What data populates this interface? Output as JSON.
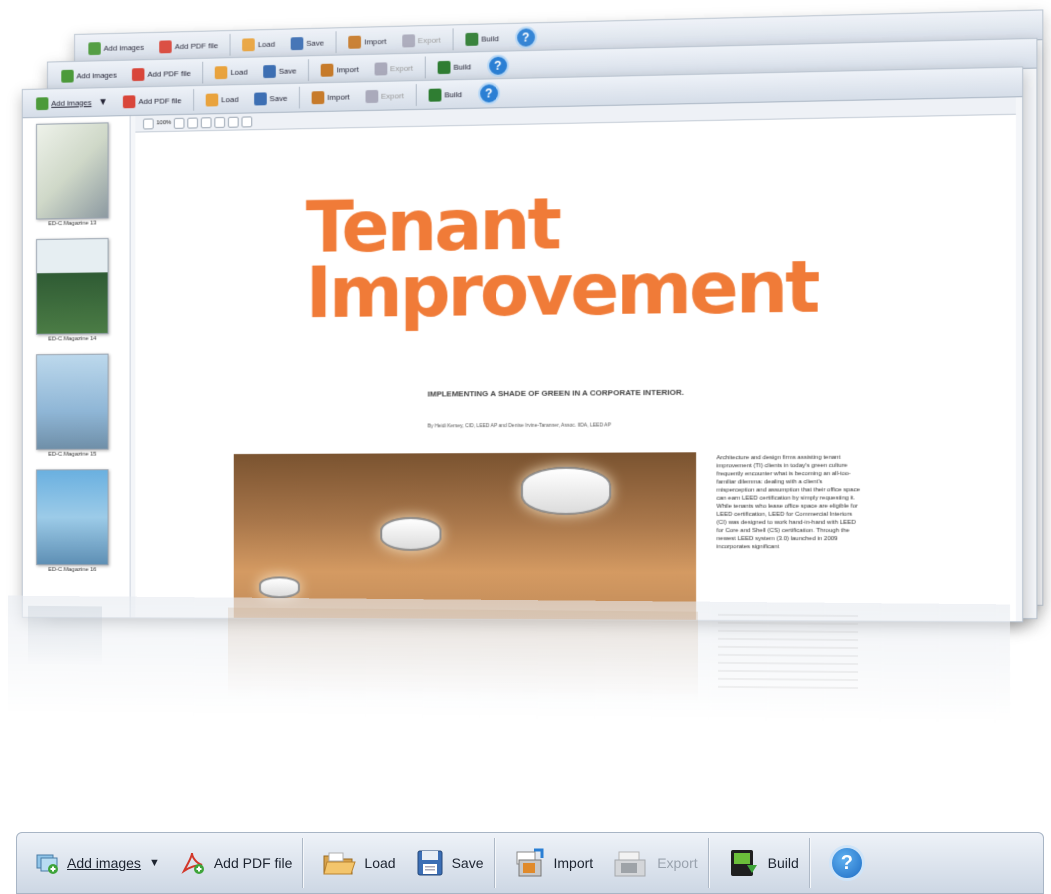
{
  "toolbar": {
    "add_images": "Add images",
    "add_pdf": "Add PDF file",
    "load": "Load",
    "save": "Save",
    "import": "Import",
    "export": "Export",
    "build": "Build",
    "help": "?"
  },
  "zoom": {
    "level": "100%"
  },
  "thumbnails": [
    {
      "label": "ED-C.Magazine 13"
    },
    {
      "label": "ED-C.Magazine 14"
    },
    {
      "label": "ED-C.Magazine 15"
    },
    {
      "label": "ED-C.Magazine 16"
    }
  ],
  "page": {
    "title_line1": "Tenant",
    "title_line2": "Improvement",
    "subtitle": "IMPLEMENTING A SHADE OF GREEN IN A CORPORATE INTERIOR.",
    "byline": "By Heidi Kersey, CID, LEED AP and Denise Irvine-Taranner, Assoc. IIDA, LEED AP",
    "body": "Architecture and design firms assisting tenant improvement (TI) clients in today's green culture frequently encounter what is becoming an all-too-familiar dilemma: dealing with a client's misperception and assumption that their office space can earn LEED certification by simply requesting it. While tenants who lease office space are eligible for LEED certification, LEED for Commercial Interiors (CI) was designed to work hand-in-hand with LEED for Core and Shell (CS) certification. Through the newest LEED system (3.0) launched in 2009 incorporates significant"
  },
  "colors": {
    "title_orange": "#f07b38",
    "toolbar_top": "#eef2f8",
    "toolbar_bottom": "#cdd7e4",
    "help_blue": "#2a7fd4"
  }
}
